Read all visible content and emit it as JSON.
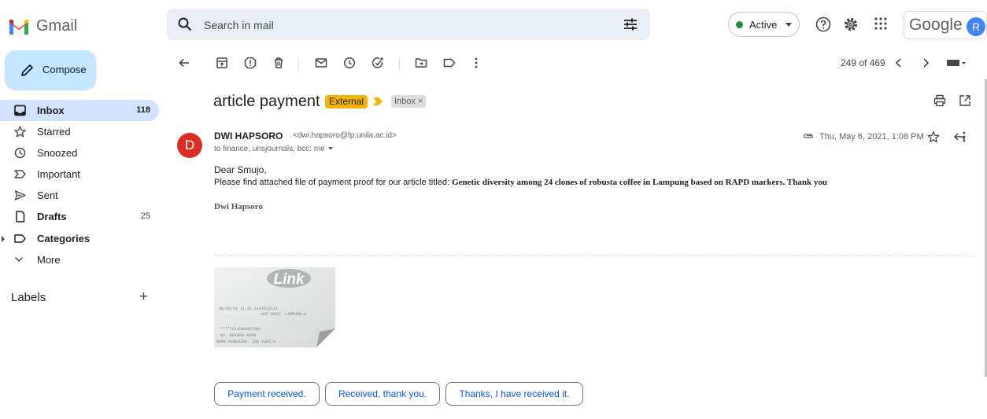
{
  "app": {
    "name": "Gmail"
  },
  "search": {
    "placeholder": "Search in mail"
  },
  "status": {
    "label": "Active",
    "color": "#1e8e3e"
  },
  "header": {
    "google_label": "Google",
    "avatar_initial": "R"
  },
  "compose": {
    "label": "Compose"
  },
  "sidebar": {
    "items": [
      {
        "label": "Inbox",
        "count": "118",
        "icon": "inbox-icon",
        "selected": true
      },
      {
        "label": "Starred",
        "count": "",
        "icon": "star-icon"
      },
      {
        "label": "Snoozed",
        "count": "",
        "icon": "clock-icon"
      },
      {
        "label": "Important",
        "count": "",
        "icon": "important-icon"
      },
      {
        "label": "Sent",
        "count": "",
        "icon": "send-icon"
      },
      {
        "label": "Drafts",
        "count": "25",
        "icon": "draft-icon"
      },
      {
        "label": "Categories",
        "count": "",
        "icon": "label-icon"
      },
      {
        "label": "More",
        "count": "",
        "icon": "chevron-down-icon"
      }
    ],
    "labels_heading": "Labels",
    "labels_add": "+"
  },
  "toolbar": {
    "count": "249 of 469"
  },
  "message": {
    "subject": "article payment",
    "badge": "External",
    "badge_color": "#f4b400",
    "chip": "Inbox ×",
    "sender_initial": "D",
    "sender_name": "DWI HAPSORO",
    "sender_email": "<dwi.hapsoro@fp.unila.ac.id>",
    "recipients": "to finance, unsjournals, bcc: me",
    "date": "Thu, May 6, 2021, 1:08 PM",
    "greeting": "Dear Smujo,",
    "body_intro": "Please find attached file of payment proof for our article titled: ",
    "body_title": "Genetic diversity among 24 clones of robusta coffee in Lampung based on RAPD markers. Thank you",
    "signature": "Dwi Hapsoro"
  },
  "attachment": {
    "logo": "Link",
    "receipt_lines": [
      "06/05/21    11:21    S1H7012111",
      "KCP UNIV. LAMPUNG-4",
      "****7614200003399",
      "NO. REKORD 4544",
      "NAMA PENERIMA: IBU  YUNITA"
    ]
  },
  "smart_replies": [
    "Payment received.",
    "Received, thank you.",
    "Thanks, I have received it."
  ]
}
